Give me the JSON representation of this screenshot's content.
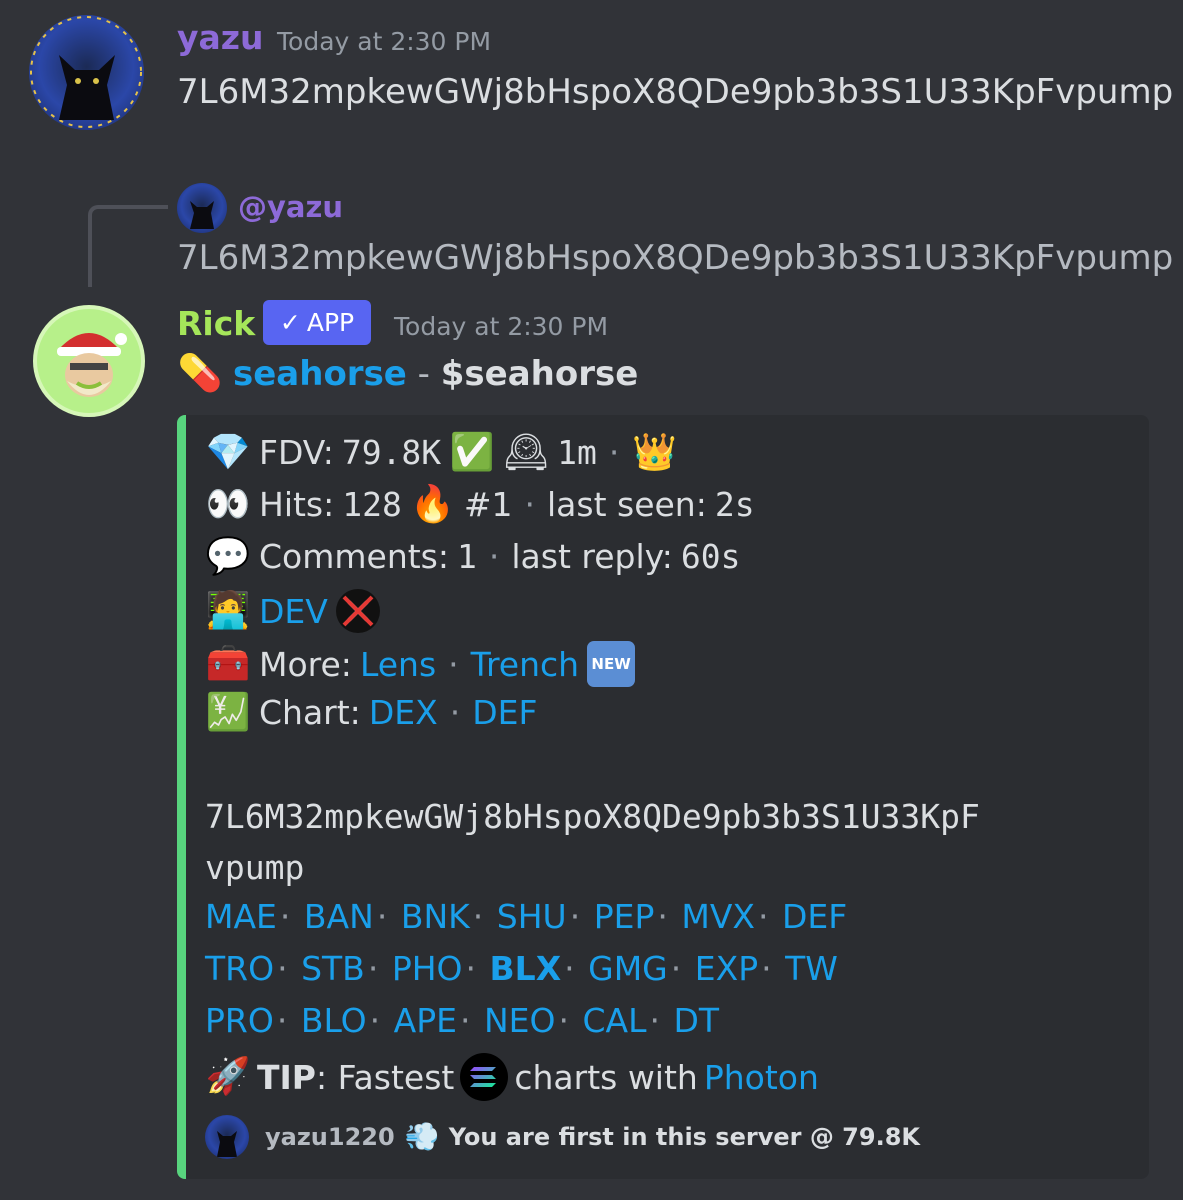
{
  "message1": {
    "username": "yazu",
    "timestamp": "Today at 2:30 PM",
    "text": "7L6M32mpkewGWj8bHspoX8QDe9pb3b3S1U33KpFvpump"
  },
  "reply": {
    "mention": "@yazu",
    "text": "7L6M32mpkewGWj8bHspoX8QDe9pb3b3S1U33KpFvpump"
  },
  "message2": {
    "username": "Rick",
    "app_badge": "APP",
    "timestamp": "Today at 2:30 PM",
    "token_name": "seahorse",
    "token_sep": " - ",
    "token_symbol": "$seahorse"
  },
  "embed": {
    "accent_color": "#58d47e",
    "fdv_label": "FDV:",
    "fdv_value": "79.8K",
    "age": "1m",
    "hits_label": "Hits:",
    "hits_value": "128",
    "rank": "#1",
    "last_seen_label": "last seen:",
    "last_seen_value": "2s",
    "comments_label": "Comments:",
    "comments_value": "1",
    "last_reply_label": "last reply:",
    "last_reply_value": "60s",
    "dev_link": "DEV",
    "more_label": "More:",
    "more_links": [
      "Lens",
      "Trench"
    ],
    "new_badge": "NEW",
    "chart_label": "Chart:",
    "chart_links": [
      "DEX",
      "DEF"
    ],
    "address_line1": "7L6M32mpkewGWj8bHspoX8QDe9pb3b3S1U33KpF",
    "address_line2": "vpump",
    "ticker_rows": [
      [
        "MAE",
        "BAN",
        "BNK",
        "SHU",
        "PEP",
        "MVX",
        "DEF"
      ],
      [
        "TRO",
        "STB",
        "PHO",
        "BLX",
        "GMG",
        "EXP",
        "TW"
      ],
      [
        "PRO",
        "BLO",
        "APE",
        "NEO",
        "CAL",
        "DT"
      ]
    ],
    "tip_label": "TIP",
    "tip_text1": ": Fastest",
    "tip_text2": "charts with",
    "tip_link": "Photon",
    "footer_user": "yazu1220",
    "footer_text": "You are first in this server @ 79.8K"
  },
  "icons": {
    "diamond": "gem-icon",
    "check": "check-mark-icon",
    "clock": "mantelpiece-clock-icon",
    "crown": "crown-icon",
    "eyes": "eyes-icon",
    "fire": "fire-icon",
    "speech": "speech-balloon-icon",
    "dev": "technologist-icon",
    "x": "x-logo-crossed-icon",
    "toolbox": "toolbox-icon",
    "chart": "chart-yen-icon",
    "rocket": "rocket-icon",
    "solana": "solana-logo-icon",
    "dash": "dash-icon",
    "pill": "pill-icon"
  }
}
